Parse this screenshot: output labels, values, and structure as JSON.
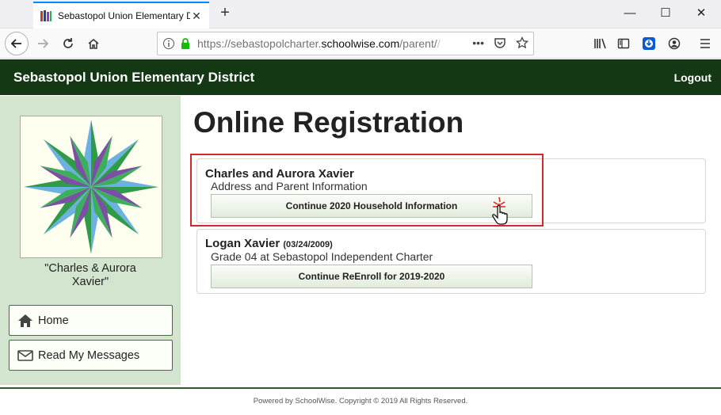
{
  "browser": {
    "tab_title": "Sebastopol Union Elementary D",
    "url_prefix": "https://sebastopolcharter.",
    "url_domain": "schoolwise.com",
    "url_suffix": "/parent/",
    "url_trail": "/",
    "new_tab_symbol": "+",
    "window_controls": {
      "minimize": "—",
      "maximize": "☐",
      "close": "✕"
    },
    "icons": [
      "back-icon",
      "forward-icon",
      "reload-icon",
      "home-icon",
      "info-icon",
      "lock-icon",
      "more-icon",
      "pocket-icon",
      "star-icon",
      "library-icon",
      "sidebar-icon",
      "download-icon",
      "account-icon",
      "menu-icon"
    ]
  },
  "header": {
    "title": "Sebastopol Union Elementary District",
    "logout_label": "Logout",
    "background": "#143814"
  },
  "sidebar": {
    "caption_line1": "\"Charles & Aurora",
    "caption_line2": "Xavier\"",
    "items": [
      {
        "label": "Home",
        "icon": "home-icon"
      },
      {
        "label": "Read My Messages",
        "icon": "envelope-icon"
      }
    ]
  },
  "main": {
    "title": "Online Registration",
    "cards": [
      {
        "name": "Charles and Aurora Xavier",
        "dob": "",
        "subtitle": "Address and Parent Information",
        "button_label": "Continue 2020 Household Information"
      },
      {
        "name": "Logan Xavier",
        "dob": "(03/24/2009)",
        "subtitle": "Grade 04 at Sebastopol Independent Charter",
        "button_label": "Continue ReEnroll for 2019-2020"
      }
    ]
  },
  "footer": {
    "text": "Powered by SchoolWise. Copyright © 2019 All Rights Reserved."
  },
  "colors": {
    "accent": "#143814",
    "highlight": "#d12a2a",
    "sidebar_bg": "#d3e4cf"
  }
}
